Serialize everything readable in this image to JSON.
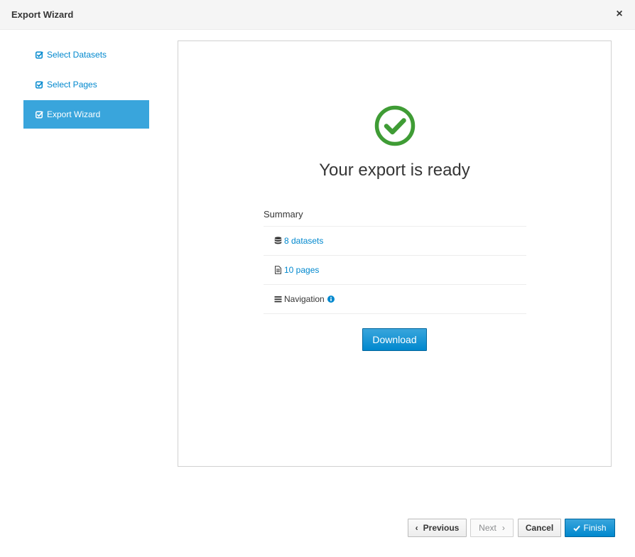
{
  "dialog": {
    "title": "Export Wizard",
    "close_glyph": "×"
  },
  "steps": [
    {
      "label": "Select Datasets",
      "icon": "check-square-icon",
      "active": false
    },
    {
      "label": "Select Pages",
      "icon": "check-square-icon",
      "active": false
    },
    {
      "label": "Export Wizard",
      "icon": "check-square-icon",
      "active": true
    }
  ],
  "result": {
    "title": "Your export is ready",
    "icon": "check-circle-icon",
    "success_color": "#3f9c35"
  },
  "summary": {
    "heading": "Summary",
    "items": [
      {
        "label": "8 datasets",
        "icon": "database-icon",
        "link": true
      },
      {
        "label": "10 pages",
        "icon": "file-icon",
        "link": true
      },
      {
        "label": "Navigation",
        "icon": "bars-icon",
        "link": false,
        "info_icon": "info-circle-icon"
      }
    ]
  },
  "actions": {
    "download_label": "Download",
    "previous_label": "Previous",
    "next_label": "Next",
    "cancel_label": "Cancel",
    "finish_label": "Finish"
  },
  "colors": {
    "accent": "#0088ce",
    "active_step": "#39a5dc"
  }
}
